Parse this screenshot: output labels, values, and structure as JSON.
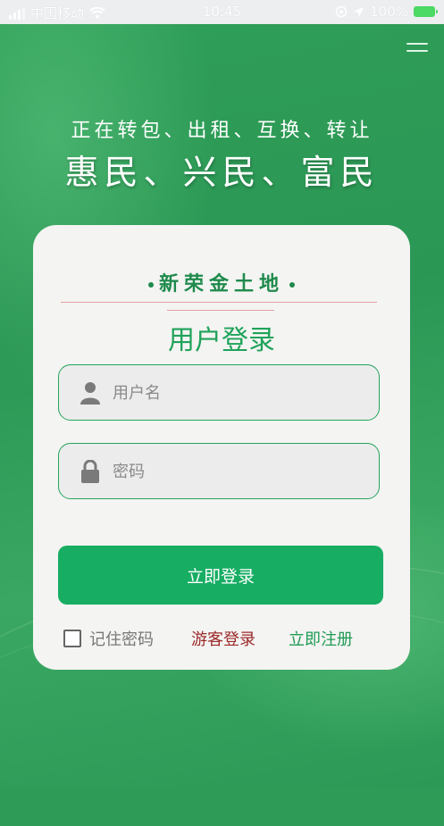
{
  "status_bar": {
    "carrier": "中国移动",
    "time": "10:45",
    "battery": "100%"
  },
  "hero": {
    "slogan_line1": "正在转包、出租、互换、转让",
    "slogan_line2": "惠民、兴民、富民"
  },
  "login": {
    "brand": "新荣金土地",
    "title": "用户登录",
    "username_placeholder": "用户名",
    "password_placeholder": "密码",
    "username_value": "",
    "password_value": "",
    "submit_label": "立即登录",
    "remember_label": "记住密码",
    "remember_checked": false,
    "guest_label": "游客登录",
    "register_label": "立即注册"
  },
  "colors": {
    "primary_green": "#17ad63",
    "guest_red": "#9b2a2a",
    "background_green": "#2e9c57"
  }
}
